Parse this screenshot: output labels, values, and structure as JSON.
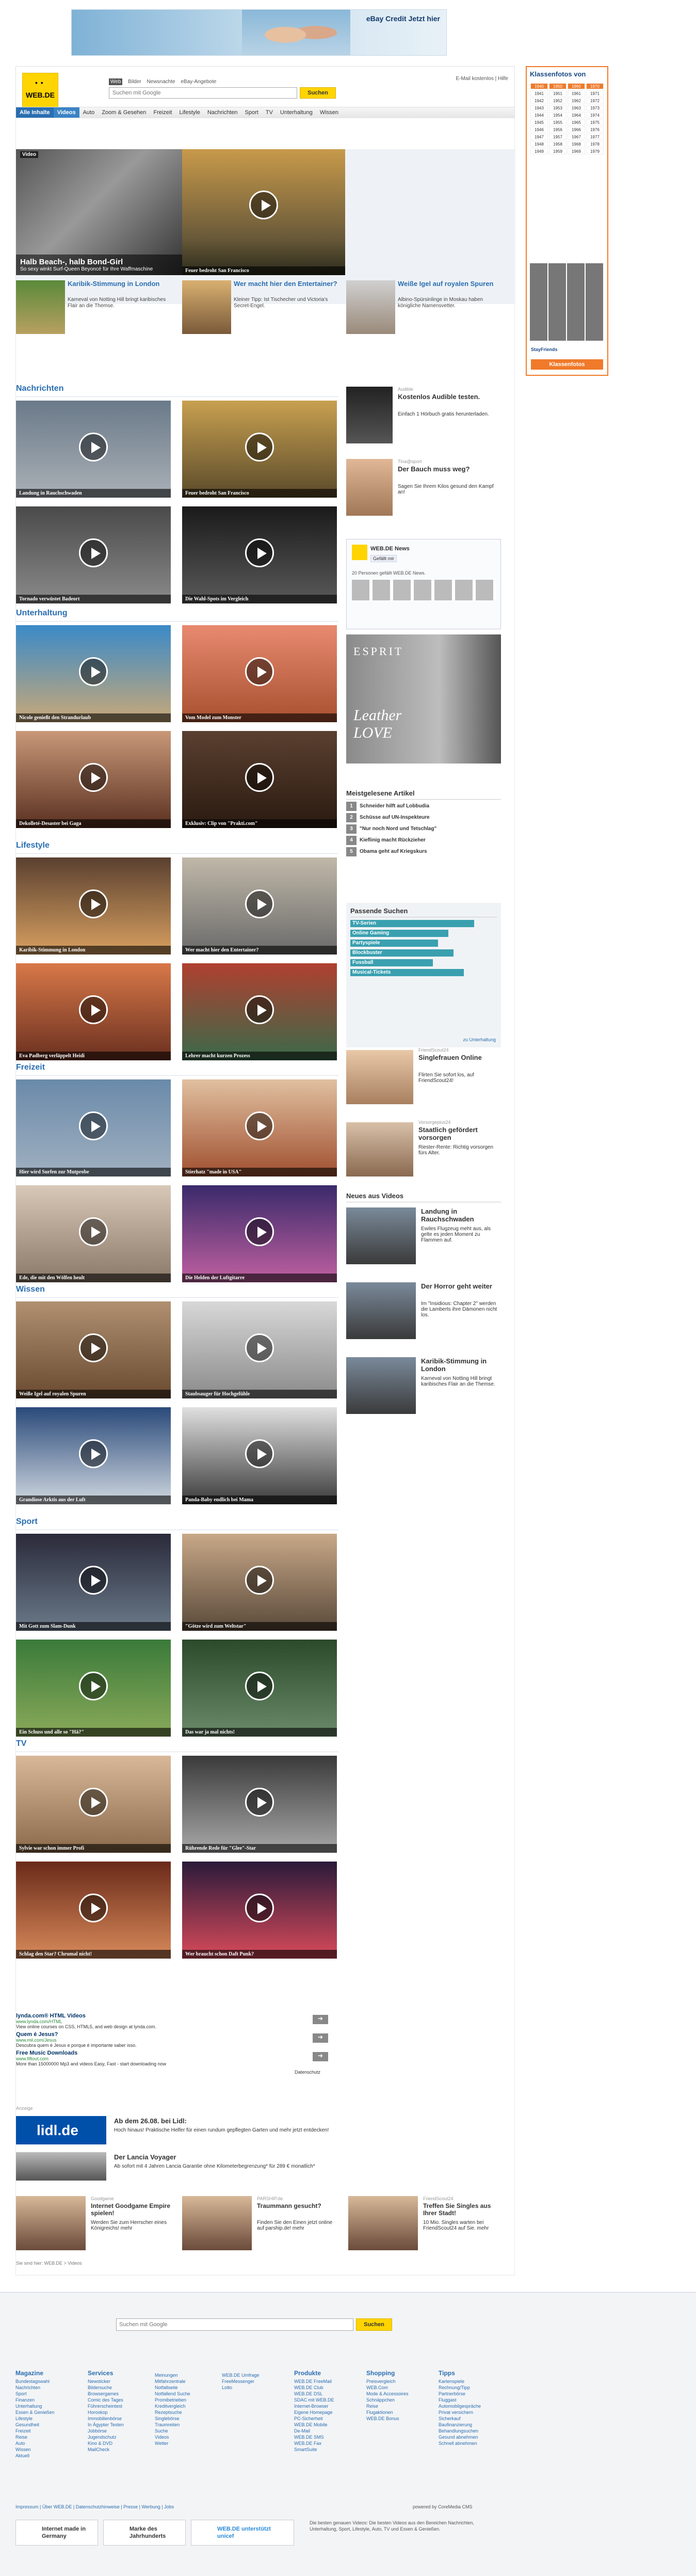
{
  "top_ad": {
    "text": "eBay Credit Jetzt hier",
    "icon": "person-icon"
  },
  "header": {
    "logo_top": "WEB.DE",
    "search_tabs": [
      "Web",
      "Bilder",
      "Newsnachte",
      "eBay-Angebote"
    ],
    "search_placeholder": "Suchen mit Google",
    "search_button": "Suchen",
    "links": "E-Mail kostenlos | Hilfe",
    "nav": [
      "Alle Inhalte",
      "Videos",
      "Auto",
      "Zoom & Gesehen",
      "Freizeit",
      "Lifestyle",
      "Nachrichten",
      "Sport",
      "TV",
      "Unterhaltung",
      "Wissen"
    ]
  },
  "sky": {
    "title": "Klassenfotos von",
    "years": [
      "1940",
      "1950",
      "1960",
      "1970",
      "1941",
      "1951",
      "1961",
      "1971",
      "1942",
      "1952",
      "1962",
      "1972",
      "1943",
      "1953",
      "1963",
      "1973",
      "1944",
      "1954",
      "1964",
      "1974",
      "1945",
      "1955",
      "1965",
      "1975",
      "1946",
      "1956",
      "1966",
      "1976",
      "1947",
      "1957",
      "1967",
      "1977",
      "1948",
      "1958",
      "1968",
      "1978",
      "1949",
      "1959",
      "1969",
      "1979"
    ],
    "footer": "StayFriends",
    "button": "Klassenfotos"
  },
  "hero": {
    "badge": "Video",
    "title": "Halb Beach-, halb Bond-Girl",
    "sub": "So sexy winkt Surf-Queen Beyoncé für Ihre Waffmaschine",
    "right_caption": "Feuer bedroht San Francisco",
    "teasers": [
      {
        "title": "Karibik-Stimmung in London",
        "body": "Karneval von Notting Hill bringt karibisches Flair an die Themse."
      },
      {
        "title": "Wer macht hier den Entertainer?",
        "body": "Kleiner Tipp: Ist Tischecher und Victoria's Secret-Engel."
      },
      {
        "title": "Weiße Igel auf royalen Spuren",
        "body": "Albino-Spürsinlinge in Moskau haben königliche Namensvetter."
      }
    ]
  },
  "sections": {
    "nachrichten": {
      "title": "Nachrichten",
      "items": [
        "Landung in Rauchschwaden",
        "Feuer bedroht San Francisco",
        "Tornado verwüstet Badeort",
        "Die Wahl-Spots im Vergleich"
      ]
    },
    "unterhaltung": {
      "title": "Unterhaltung",
      "items": [
        "Nicole genießt den Strandurlaub",
        "Vom Model zum Monster",
        "Dekolleté-Desaster bei Gaga",
        "Exklusiv: Clip von \"Prakti.com\""
      ]
    },
    "lifestyle": {
      "title": "Lifestyle",
      "items": [
        "Karibik-Stimmung in London",
        "Wer macht hier den Entertainer?",
        "Eva Padberg verläppelt Heidi",
        "Lehrer macht kurzen Prozess"
      ]
    },
    "freizeit": {
      "title": "Freizeit",
      "items": [
        "Hier wird Surfen zur Mutprobe",
        "Stierhatz \"made in USA\"",
        "Ede, die mit den Wölfen heult",
        "Die Helden der Luftgitarre"
      ]
    },
    "wissen": {
      "title": "Wissen",
      "items": [
        "Weiße Igel auf royalen Spuren",
        "Staubsauger für Hochgefühle",
        "Grandiose Arktis aus der Luft",
        "Panda-Baby endlich bei Mama"
      ]
    },
    "sport": {
      "title": "Sport",
      "items": [
        "Mit Gott zum Slam-Dunk",
        "\"Götze wird zum Weltstar\"",
        "Ein Schuss und alle so \"Hä?\"",
        "Das war ja mal nichts!"
      ]
    },
    "tv": {
      "title": "TV",
      "items": [
        "Sylvie war schon immer Profi",
        "Rührende Rede für \"Glee\"-Star",
        "Schlag den Star? Chrumal nicht!",
        "Wer braucht schon Daft Punk?"
      ]
    }
  },
  "right": {
    "ad1_title": "Kostenlos Audible testen.",
    "ad1_body": "Einfach 1 Hörbuch gratis herunterladen.",
    "ad1_src": "Audible",
    "ad2_title": "Der Bauch muss weg?",
    "ad2_body": "Sagen Sie Ihrem Kilos gesund den Kampf an!",
    "ad2_src": "Tina@sport",
    "social_title": "WEB.DE News",
    "social_like": "Gefällt mir",
    "social_count": "20 Personen gefällt WEB.DE News.",
    "fashion_brand": "ESPRIT",
    "fashion_text": "Leather LOVE",
    "most_read_title": "Meistgelesene Artikel",
    "most_read": [
      "Schneider hilft auf Lobbudia",
      "Schüsse auf UN-Inspekteure",
      "\"Nur noch Nord und Tetschlag\"",
      "Kieflinig macht Rückzieher",
      "Obama geht auf Kriegskurs"
    ],
    "suggest_title": "Passende Suchen",
    "suggest": [
      "TV-Serien",
      "Online Gaming",
      "Partyspiele",
      "Blockbuster",
      "Fussball",
      "Musical-Tickets"
    ],
    "suggest_more": "zu Unterhaltung",
    "ad3_title": "Singlefrauen Online",
    "ad3_body": "Flirten Sie sofort los, auf FriendScout24!",
    "ad3_src": "FriendScout24",
    "ad4_title": "Staatlich gefördert vorsorgen",
    "ad4_body": "Riester-Rente: Richtig vorsorgen fürs Alter.",
    "ad4_src": "Vorsorgeplus24",
    "more": "mehr",
    "news_title": "Neues aus Videos",
    "news": [
      {
        "t": "Landung in Rauchschwaden",
        "b": "Ewiles Flugzeug meht aus, als gelte es jeden Moment zu Flammen auf."
      },
      {
        "t": "Der Horror geht weiter",
        "b": "Im \"Insidious: Chapter 2\" werden die Lamberts ihre Dämonen nicht los."
      },
      {
        "t": "Karibik-Stimmung in London",
        "b": "Karneval von Notting Hill bringt karibisches Flair an die Themse."
      }
    ]
  },
  "links_ads": [
    {
      "t": "lynda.com® HTML Videos",
      "u": "www.lynda.com/HTML",
      "b": "View online courses on CSS, HTML5, and web design at lynda.com."
    },
    {
      "t": "Quem é Jesus?",
      "u": "www.mil.com/Jesus",
      "b": "Descubra quem é Jesus e porque é importante saber isso."
    },
    {
      "t": "Free Music Downloads",
      "u": "www.fiftout.com",
      "b": "More than 15000000 Mp3 and videos Easy, Fast - start downloading now"
    }
  ],
  "ads_label": "Datenschutz",
  "anzeige": "Anzeige",
  "lidl": {
    "logo": "lidl.de",
    "t": "Ab dem 26.08. bei Lidl:",
    "b": "Hoch hinaus! Praktische Helfer für einen rundum gepflegten Garten und mehr jetzt entdecken!"
  },
  "lancia": {
    "t": "Der Lancia Voyager",
    "b": "Ab sofort mit 4 Jahren Lancia Garantie ohne Kilometerbegrenzung* für 289 € monatlich*"
  },
  "bottom_ads": [
    {
      "src": "Goodgame",
      "t": "Internet Goodgame Empire spielen!",
      "b": "Werden Sie zum Herrscher eines Königreichs! mehr"
    },
    {
      "src": "PARSHIP.de",
      "t": "Traummann gesucht?",
      "b": "Finden Sie den Einen jetzt online auf parship.de! mehr"
    },
    {
      "src": "FriendScout24",
      "t": "Treffen Sie Singles aus Ihrer Stadt!",
      "b": "10 Mio. Singles warten bei FriendScout24 auf Sie. mehr"
    }
  ],
  "breadcrumb": "Sie sind hier: WEB.DE > Videos",
  "footer": {
    "search_placeholder": "Suchen mit Google",
    "search_btn": "Suchen",
    "cols": [
      {
        "t": "Magazine",
        "items": [
          "Bundestagswahl",
          "Nachrichten",
          "Sport",
          "Finanzen",
          "Unterhaltung",
          "Essen & Genießen",
          "Lifestyle",
          "Gesundheit",
          "Freizeit",
          "Reise",
          "Auto",
          "Wissen",
          "Aktuell"
        ]
      },
      {
        "t": "Services",
        "items": [
          "Newsticker",
          "Bildersuche",
          "Browsergames",
          "Comic des Tages",
          "Führerscheintest",
          "Horoskop",
          "Immobilienbörse",
          "In Ägypter Testen",
          "Jobbörse",
          "Jugendschutz",
          "Kino & DVD",
          "MailCheck"
        ]
      },
      {
        "t": "",
        "items": [
          "Meinungen",
          "Mitfahrzentrale",
          "Notfallseite",
          "Notfallend Suche",
          "Promibetrieben",
          "Kreditvergleich",
          "Rezeptsuche",
          "Singlebörse",
          "Traumreiten",
          "Suche",
          "Videos",
          "Wetter"
        ]
      },
      {
        "t": "",
        "items": [
          "WEB.DE Umfrage",
          "FreeMessenger",
          "Lotto"
        ]
      },
      {
        "t": "Produkte",
        "items": [
          "WEB.DE FreeMail",
          "WEB.DE Club",
          "WEB.DE DSL",
          "SDAC mit WEB.DE",
          "Internet-Browser",
          "Eigene Homepage",
          "PC-Sicherheit",
          "WEB.DE Mobile",
          "De-Mail",
          "WEB.DE SMS",
          "WEB.DE Fax",
          "SmartSuite"
        ]
      },
      {
        "t": "Shopping",
        "items": [
          "Preisvergleich",
          "WEB.Com",
          "Mode & Accessoires",
          "Schnäppchen",
          "Reise",
          "Flugaktionen",
          "WEB.DE Bonus"
        ]
      },
      {
        "t": "Tipps",
        "items": [
          "Kartenspiele",
          "Rechnung/Tipp",
          "Partnerbörse",
          "Fluggast",
          "Automobilgespräche",
          "Privat versichern",
          "Sicherkauf",
          "Baufinanzierung",
          "Behandlungsuchen",
          "Gesund abnehmen",
          "Schnell abnehmen"
        ]
      }
    ],
    "bottom_links": "Impressum | Über WEB.DE | Datenschutzhinweise | Presse | Werbung | Jobs",
    "powered": "powered by CoreMedia CMS",
    "badges": [
      "Internet made in Germany",
      "Marke des Jahrhunderts",
      "WEB.DE unterstützt unicef"
    ],
    "desc": "Die besten genauen Videos: Die besten Videos aus den Bereichen Nachrichten, Unterhaltung, Sport, Lifestyle, Auto, TV und Essen & Genießen."
  }
}
